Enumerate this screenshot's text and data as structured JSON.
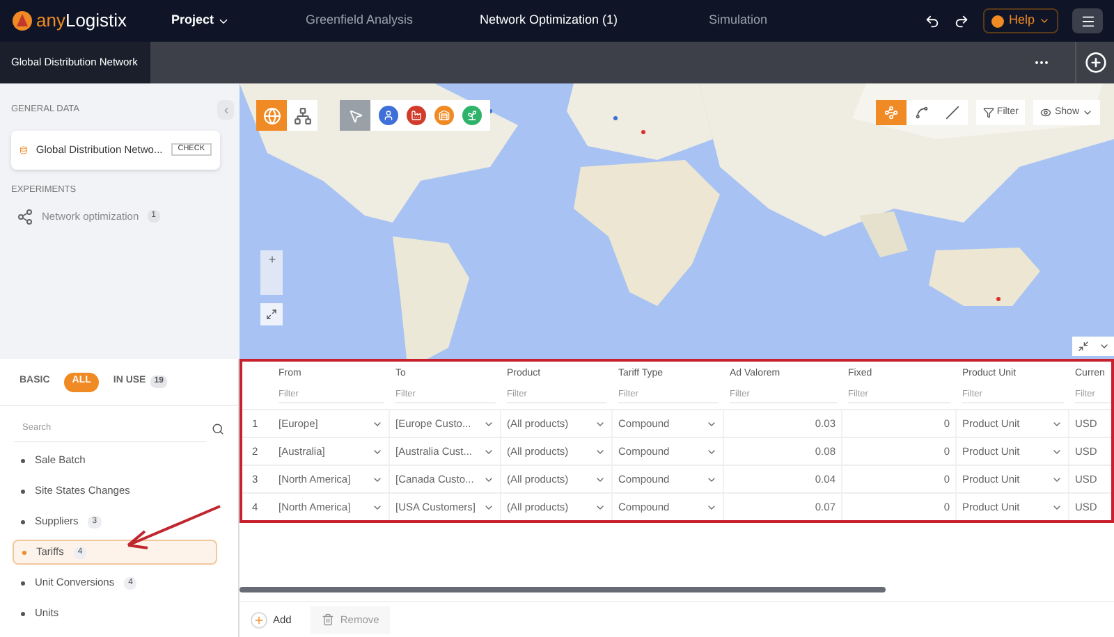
{
  "header": {
    "logo_prefix": "any",
    "logo_name": "Logistix",
    "nav": [
      {
        "label": "Project",
        "kind": "menu"
      },
      {
        "label": "Greenfield Analysis",
        "kind": "tab",
        "selected": false
      },
      {
        "label": "Network Optimization (1)",
        "kind": "tab",
        "selected": true
      },
      {
        "label": "Simulation",
        "kind": "tab",
        "selected": false
      }
    ],
    "help": "Help"
  },
  "doc_tab": {
    "title": "Global Distribution Network"
  },
  "sidebar": {
    "general_heading": "GENERAL DATA",
    "scenario": {
      "name": "Global Distribution Netwo...",
      "button": "CHECK"
    },
    "experiments_heading": "EXPERIMENTS",
    "experiments": [
      {
        "name": "Network optimization",
        "count": "1"
      }
    ]
  },
  "filters": [
    {
      "label": "BASIC",
      "selected": false
    },
    {
      "label": "ALL",
      "selected": true
    },
    {
      "label": "IN USE",
      "count": "19",
      "selected": false
    }
  ],
  "search": {
    "placeholder": "Search"
  },
  "data_tables": [
    {
      "label": "Sale Batch",
      "selected": false
    },
    {
      "label": "Site States Changes",
      "selected": false
    },
    {
      "label": "Suppliers",
      "count": "3",
      "selected": false
    },
    {
      "label": "Tariffs",
      "count": "4",
      "selected": true
    },
    {
      "label": "Unit Conversions",
      "count": "4",
      "selected": false
    },
    {
      "label": "Units",
      "selected": false
    }
  ],
  "map": {
    "views": [
      {
        "kind": "globe",
        "selected": true
      },
      {
        "kind": "graph",
        "selected": false
      }
    ],
    "tools": [
      {
        "kind": "cursor",
        "color": "#9aa0a8"
      },
      {
        "kind": "customer",
        "color": "#3f6fd9"
      },
      {
        "kind": "factory",
        "color": "#d13b2a"
      },
      {
        "kind": "warehouse",
        "color": "#f08a24"
      },
      {
        "kind": "supplier",
        "color": "#2fb36b"
      }
    ],
    "layers": [
      {
        "kind": "points",
        "selected": true
      },
      {
        "kind": "routes",
        "selected": false
      },
      {
        "kind": "lines",
        "selected": false
      }
    ],
    "filter": "Filter",
    "show": "Show"
  },
  "table": {
    "columns": [
      {
        "label": "From",
        "kind": "select",
        "placeholder": "Filter"
      },
      {
        "label": "To",
        "kind": "select",
        "placeholder": "Filter"
      },
      {
        "label": "Product",
        "kind": "select",
        "placeholder": "Filter"
      },
      {
        "label": "Tariff Type",
        "kind": "select",
        "placeholder": "Filter"
      },
      {
        "label": "Ad Valorem",
        "kind": "number",
        "placeholder": "Filter"
      },
      {
        "label": "Fixed",
        "kind": "number",
        "placeholder": "Filter"
      },
      {
        "label": "Product Unit",
        "kind": "select",
        "placeholder": "Filter"
      },
      {
        "label": "Curren",
        "kind": "text",
        "placeholder": "Filter"
      }
    ],
    "rows": [
      {
        "index": "1",
        "cells": [
          "[Europe]",
          "[Europe Custo...",
          "(All products)",
          "Compound",
          "0.03",
          "0",
          "Product Unit",
          "USD"
        ]
      },
      {
        "index": "2",
        "cells": [
          "[Australia]",
          "[Australia Cust...",
          "(All products)",
          "Compound",
          "0.08",
          "0",
          "Product Unit",
          "USD"
        ]
      },
      {
        "index": "3",
        "cells": [
          "[North America]",
          "[Canada Custo...",
          "(All products)",
          "Compound",
          "0.04",
          "0",
          "Product Unit",
          "USD"
        ]
      },
      {
        "index": "4",
        "cells": [
          "[North America]",
          "[USA Customers]",
          "(All products)",
          "Compound",
          "0.07",
          "0",
          "Product Unit",
          "USD"
        ]
      }
    ]
  },
  "footer": {
    "add": "Add",
    "remove": {
      "label": "Remove",
      "disabled": true
    }
  }
}
